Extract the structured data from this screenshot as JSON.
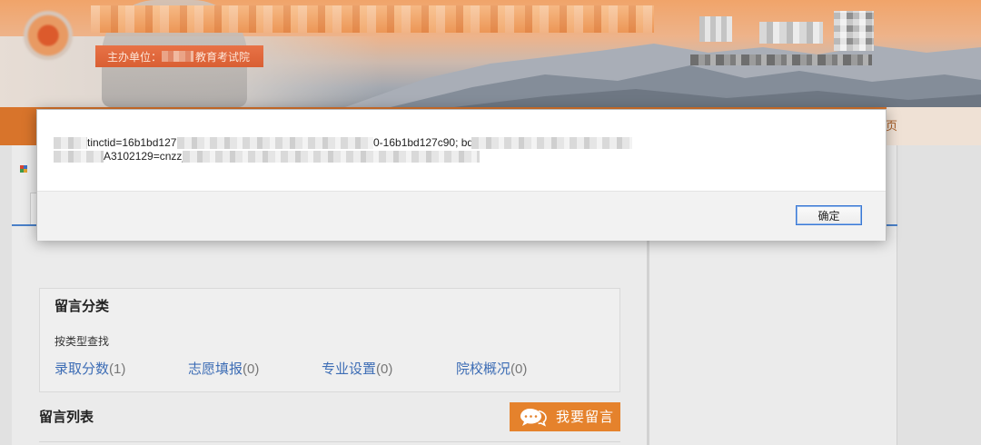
{
  "header": {
    "sponsor_label": "主办单位：",
    "sponsor_org": "教育考试院"
  },
  "nav": {
    "home_fragment": "页"
  },
  "category_box": {
    "title": "留言分类",
    "search_by_type": "按类型查找",
    "categories": [
      {
        "label": "录取分数",
        "count": "(1)"
      },
      {
        "label": "志愿填报",
        "count": "(0)"
      },
      {
        "label": "专业设置",
        "count": "(0)"
      },
      {
        "label": "院校概况",
        "count": "(0)"
      }
    ]
  },
  "message_list": {
    "title": "留言列表",
    "post_button": "我要留言"
  },
  "alert": {
    "line1_segment1": "tinctid=16b1bd127",
    "line1_segment2": "0-16b1bd127c90; bd",
    "line2_segment1": "A3102129=cnzz_",
    "ok_label": "确定"
  },
  "icons": {
    "emblem": "site-emblem-icon",
    "breadcrumb": "location-grid-icon",
    "post_button": "speech-bubble-icon"
  },
  "colors": {
    "nav_orange": "#d8742b",
    "link_blue": "#3d6db5",
    "button_orange": "#e5822c",
    "tab_blue": "#4a80c8",
    "dialog_button_border": "#3a78d4"
  }
}
